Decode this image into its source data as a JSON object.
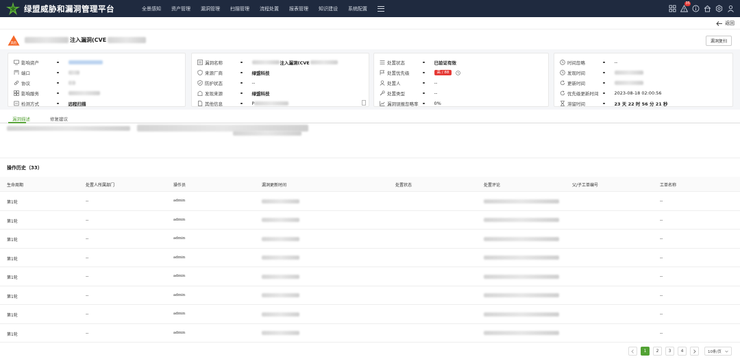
{
  "app": {
    "title": "绿盟威胁和漏洞管理平台"
  },
  "nav": {
    "items": [
      "全景感知",
      "资产管理",
      "漏洞管理",
      "扫描管理",
      "流程处置",
      "报表管理",
      "知识建设",
      "系统配置"
    ]
  },
  "topbar": {
    "alert_count": "35"
  },
  "back": {
    "label": "返回"
  },
  "vuln": {
    "level_tag": "高危",
    "title_suffix": "注入漏洞(CVE",
    "review_button": "漏洞复扫"
  },
  "card1": [
    {
      "icon": "monitor-icon",
      "label": "影响资产",
      "value": ""
    },
    {
      "icon": "port-icon",
      "label": "端口",
      "value": ""
    },
    {
      "icon": "link-icon",
      "label": "协议",
      "value": ""
    },
    {
      "icon": "grid-icon",
      "label": "影响服务",
      "value": ""
    },
    {
      "icon": "scan-icon",
      "label": "检测方式",
      "value": "远程扫描"
    }
  ],
  "card2": [
    {
      "icon": "list-icon",
      "label": "漏洞名称",
      "value": "注入漏洞(CVE"
    },
    {
      "icon": "shield-icon",
      "label": "来源厂商",
      "value": "绿盟科技"
    },
    {
      "icon": "shield-check-icon",
      "label": "防护状态",
      "value": "--"
    },
    {
      "icon": "building-icon",
      "label": "发现来源",
      "value": "绿盟科技"
    },
    {
      "icon": "document-icon",
      "label": "其他信息",
      "value": "P"
    }
  ],
  "card3": [
    {
      "icon": "list-icon",
      "label": "处置状态",
      "value": "已验证有效"
    },
    {
      "icon": "flag-icon",
      "label": "处置优先级",
      "value": "高 / 88"
    },
    {
      "icon": "user-icon",
      "label": "处置人",
      "value": "--"
    },
    {
      "icon": "wrench-icon",
      "label": "处置类型",
      "value": "--"
    },
    {
      "icon": "chart-icon",
      "label": "漏洞误报忽略率",
      "value": "0%"
    }
  ],
  "card4": [
    {
      "icon": "clock-icon",
      "label": "时间忽略",
      "value": "--"
    },
    {
      "icon": "clock-icon",
      "label": "发现时间",
      "value": ""
    },
    {
      "icon": "refresh-icon",
      "label": "更新时间",
      "value": ""
    },
    {
      "icon": "refresh-icon",
      "label": "优先级更新时间",
      "value": "2023-08-18 02:00:56"
    },
    {
      "icon": "hourglass-icon",
      "label": "滞留时间",
      "value": "23 天 22 时 56 分 21 秒"
    }
  ],
  "tabs": [
    "漏洞描述",
    "修复建议"
  ],
  "history": {
    "title": "操作历史（33）",
    "columns": [
      "生命周期",
      "处置人所属部门",
      "操作员",
      "漏洞更新时间",
      "处置状态",
      "处置评论",
      "父/子工单编号",
      "工单名称"
    ],
    "rows": [
      {
        "cycle": "第1轮",
        "dept": "--",
        "operator": "admin",
        "ticket_name": "--"
      },
      {
        "cycle": "第1轮",
        "dept": "--",
        "operator": "admin",
        "ticket_name": "--"
      },
      {
        "cycle": "第1轮",
        "dept": "--",
        "operator": "admin",
        "ticket_name": "--"
      },
      {
        "cycle": "第1轮",
        "dept": "--",
        "operator": "admin",
        "ticket_name": "--"
      },
      {
        "cycle": "第1轮",
        "dept": "--",
        "operator": "admin",
        "ticket_name": "--"
      },
      {
        "cycle": "第1轮",
        "dept": "--",
        "operator": "admin",
        "ticket_name": "--"
      },
      {
        "cycle": "第1轮",
        "dept": "--",
        "operator": "admin",
        "ticket_name": "--"
      },
      {
        "cycle": "第1轮",
        "dept": "--",
        "operator": "admin",
        "ticket_name": "--"
      }
    ]
  },
  "pagination": {
    "pages": [
      "1",
      "2",
      "3",
      "4"
    ],
    "current": "1",
    "page_size": "10条/页"
  },
  "colors": {
    "accent": "#52a234",
    "topbar": "#1f2a3f",
    "danger": "#e53935"
  }
}
